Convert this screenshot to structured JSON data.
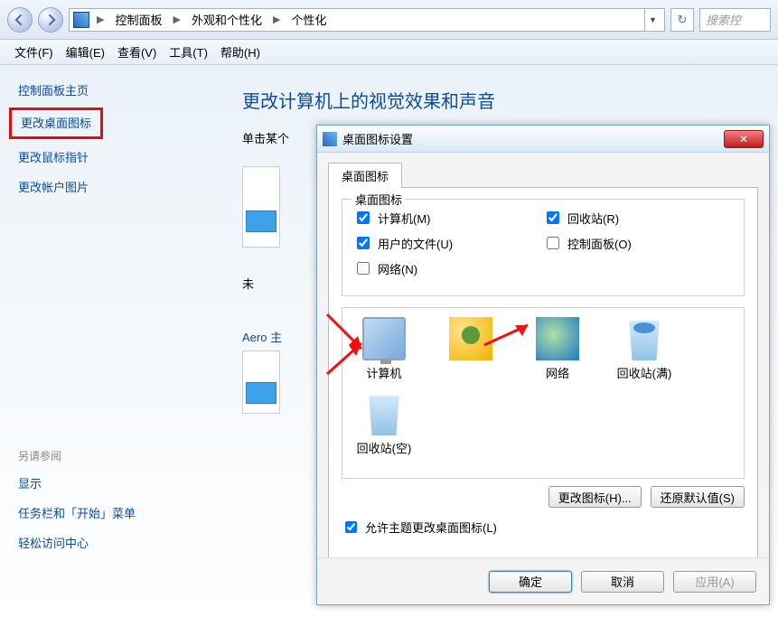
{
  "breadcrumb": {
    "root": "控制面板",
    "mid": "外观和个性化",
    "leaf": "个性化"
  },
  "search_placeholder": "搜索控",
  "menu": {
    "file": "文件(F)",
    "edit": "编辑(E)",
    "view": "查看(V)",
    "tools": "工具(T)",
    "help": "帮助(H)"
  },
  "sidebar": {
    "home": "控制面板主页",
    "change_desktop_icons": "更改桌面图标",
    "change_mouse_pointer": "更改鼠标指针",
    "change_account_pic": "更改帐户图片",
    "see_also": "另请参阅",
    "display": "显示",
    "taskbar": "任务栏和「开始」菜单",
    "ease": "轻松访问中心"
  },
  "main": {
    "heading": "更改计算机上的视觉效果和声音",
    "subtext_prefix": "单击某个",
    "aero_label": "Aero 主",
    "unnamed": "未"
  },
  "dialog": {
    "title": "桌面图标设置",
    "tab": "桌面图标",
    "group_legend": "桌面图标",
    "checks": {
      "computer": {
        "label": "计算机(M)",
        "checked": true
      },
      "userfiles": {
        "label": "用户的文件(U)",
        "checked": true
      },
      "network": {
        "label": "网络(N)",
        "checked": false
      },
      "recyclebin": {
        "label": "回收站(R)",
        "checked": true
      },
      "cpanel": {
        "label": "控制面板(O)",
        "checked": false
      }
    },
    "icons": {
      "computer": "计算机",
      "user": "",
      "network": "网络",
      "bin_full": "回收站(满)",
      "bin_empty": "回收站(空)"
    },
    "change_icon_btn": "更改图标(H)...",
    "restore_default_btn": "还原默认值(S)",
    "allow_themes": "允许主题更改桌面图标(L)",
    "ok": "确定",
    "cancel": "取消",
    "apply": "应用(A)"
  }
}
